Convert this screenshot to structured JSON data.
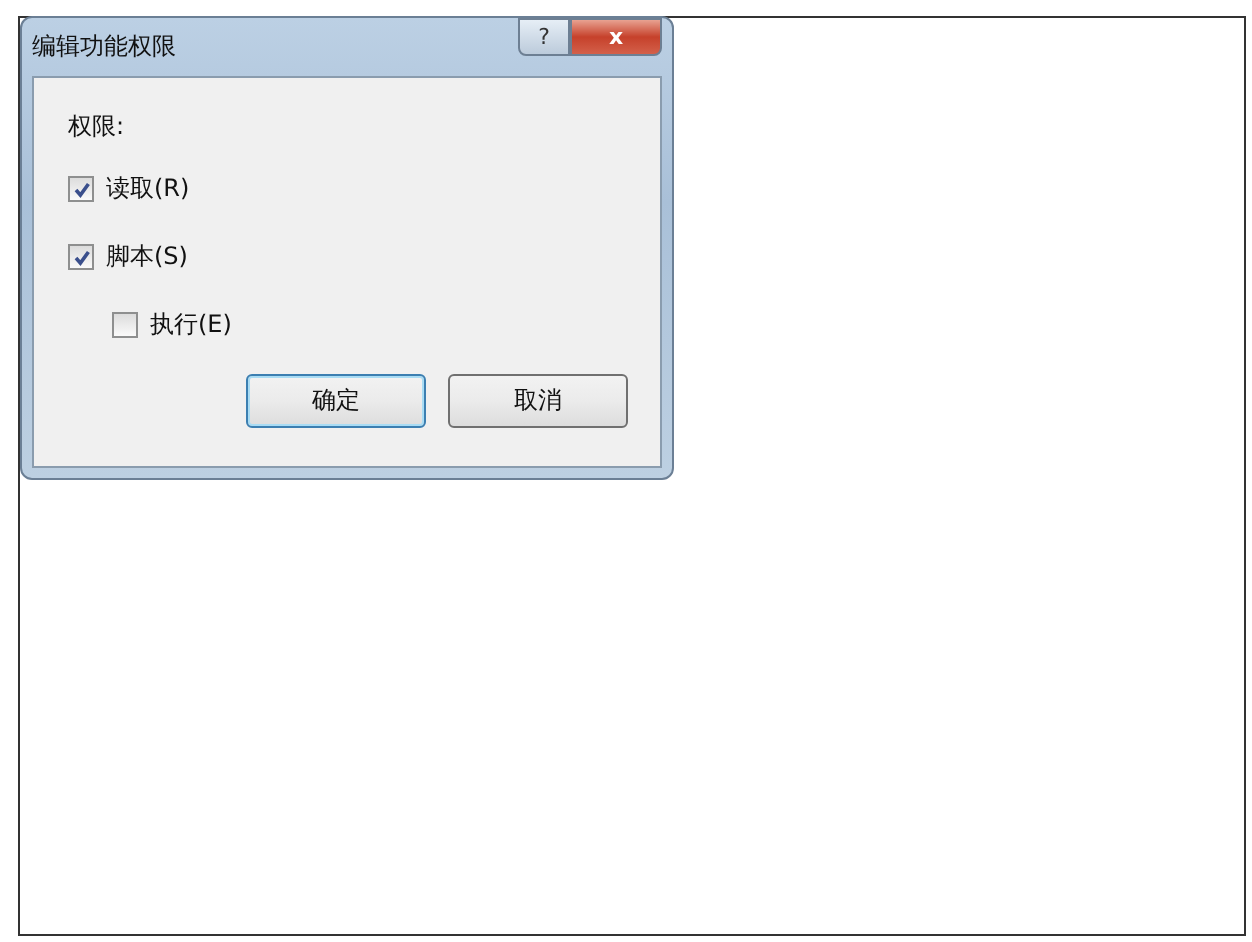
{
  "window": {
    "title": "编辑功能权限",
    "help_button": "?",
    "close_button": "x"
  },
  "group_label": "权限:",
  "options": [
    {
      "label": "读取(R)",
      "checked": true
    },
    {
      "label": "脚本(S)",
      "checked": true,
      "children": [
        {
          "label": "执行(E)",
          "checked": false
        }
      ]
    }
  ],
  "buttons": [
    {
      "label": "确定",
      "default": true
    },
    {
      "label": "取消",
      "default": false
    }
  ]
}
